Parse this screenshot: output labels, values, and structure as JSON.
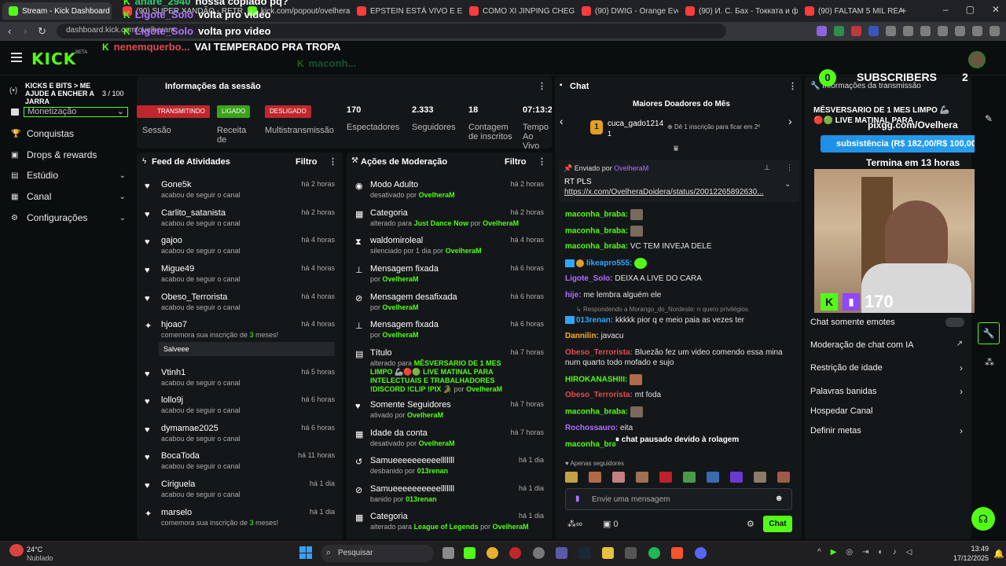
{
  "browser": {
    "tabs": [
      {
        "label": "Stream - Kick Dashboard",
        "active": true,
        "fav": "#53fc18"
      },
      {
        "label": "(90) SUPER XANDÃO - RETRA",
        "fav": "#ff3b3b"
      },
      {
        "label": "kick.com/popout/ovelheram/c",
        "fav": "#53fc18"
      },
      {
        "label": "EPSTEIN ESTÁ VIVO E EU POSS",
        "fav": "#ff3b3b"
      },
      {
        "label": "COMO XI JINPING CHEGOU AO",
        "fav": "#ff3b3b"
      },
      {
        "label": "(90) DWIG - Orange Evening /",
        "fav": "#ff3b3b"
      },
      {
        "label": "(90) И. С. Бах - Токката и фуга",
        "fav": "#ff3b3b"
      },
      {
        "label": "(90) FALTAM 5 MIL REAIS PARA",
        "fav": "#ff3b3b"
      }
    ],
    "new_tab": "+",
    "url": "dashboard.kick.com/ovelheram"
  },
  "overlay": {
    "lines": [
      {
        "user": "anare_2940",
        "text": "nossa copiado pq?"
      },
      {
        "user": "Ligote_Solo",
        "text": "volta pro video",
        "color": "pink"
      },
      {
        "user": "Ligote_Solo",
        "text": "volta pro video",
        "color": "pink"
      },
      {
        "user": "nenemquerbo...",
        "text": "VAI TEMPERADO PRA TROPA",
        "color": "red"
      },
      {
        "user": "maconh...",
        "text": ""
      }
    ]
  },
  "kick": {
    "logo": "KICK",
    "beta": "BETA"
  },
  "goal": {
    "title": "KICKS E BITS > ME AJUDE A ENCHER A JARRA",
    "count": "3 / 100",
    "monetization": "Monetização"
  },
  "sidebar": {
    "items": [
      {
        "label": "Conquistas",
        "icon": "trophy-icon",
        "chevron": false
      },
      {
        "label": "Drops & rewards",
        "icon": "gift-icon",
        "chevron": false
      },
      {
        "label": "Estúdio",
        "icon": "studio-icon",
        "chevron": true
      },
      {
        "label": "Canal",
        "icon": "channel-icon",
        "chevron": true
      },
      {
        "label": "Configurações",
        "icon": "gear-icon",
        "chevron": true
      }
    ]
  },
  "session": {
    "title": "Informações da sessão",
    "badges": [
      {
        "label": "TRANSMITINDO",
        "color": "#c0272d"
      },
      {
        "label": "LIGADO",
        "color": "#3aa31a"
      },
      {
        "label": "DESLIGADO",
        "color": "#c0272d"
      }
    ],
    "badge_captions": [
      "Sessão",
      "Receita de",
      "Multistransmissão"
    ],
    "stats": [
      {
        "value": "170",
        "label": "Espectadores"
      },
      {
        "value": "2.333",
        "label": "Seguidores"
      },
      {
        "value": "18",
        "label": "Contagem de inscritos"
      },
      {
        "value": "07:13:22",
        "label": "Tempo Ao Vivo"
      }
    ]
  },
  "feed": {
    "title": "Feed de Atividades",
    "filter": "Filtro",
    "rows": [
      {
        "name": "Gone5k",
        "desc": "acabou de seguir o canal",
        "time": "há 2 horas",
        "icon": "heart"
      },
      {
        "name": "Carlito_satanista",
        "desc": "acabou de seguir o canal",
        "time": "há 2 horas",
        "icon": "heart"
      },
      {
        "name": "gajoo",
        "desc": "acabou de seguir o canal",
        "time": "há 4 horas",
        "icon": "heart"
      },
      {
        "name": "Migue49",
        "desc": "acabou de seguir o canal",
        "time": "há 4 horas",
        "icon": "heart"
      },
      {
        "name": "Obeso_Terrorista",
        "desc": "acabou de seguir o canal",
        "time": "há 4 horas",
        "icon": "heart"
      },
      {
        "name": "hjoao7",
        "desc_pre": "comemora sua inscrição de ",
        "desc_num": "3",
        "desc_post": " meses!",
        "time": "há 4 horas",
        "icon": "star",
        "msg": "Salveee"
      },
      {
        "name": "Vtinh1",
        "desc": "acabou de seguir o canal",
        "time": "há 5 horas",
        "icon": "heart"
      },
      {
        "name": "lollo9j",
        "desc": "acabou de seguir o canal",
        "time": "há 6 horas",
        "icon": "heart"
      },
      {
        "name": "dymamae2025",
        "desc": "acabou de seguir o canal",
        "time": "há 6 horas",
        "icon": "heart"
      },
      {
        "name": "BocaToda",
        "desc": "acabou de seguir o canal",
        "time": "há 11 horas",
        "icon": "heart"
      },
      {
        "name": "Ciriguela",
        "desc": "acabou de seguir o canal",
        "time": "há 1 dia",
        "icon": "heart"
      },
      {
        "name": "marselo",
        "desc_pre": "comemora sua inscrição de ",
        "desc_num": "3",
        "desc_post": " meses!",
        "time": "há 1 dia",
        "icon": "star"
      }
    ]
  },
  "moderation": {
    "title": "Ações de Moderação",
    "filter": "Filtro",
    "rows": [
      {
        "name": "Modo Adulto",
        "desc": "desativado por",
        "by": "OvelheraM",
        "time": "há 2 horas",
        "icon": "eye"
      },
      {
        "name": "Categoria",
        "desc": "alterado para",
        "extra": "Just Dance Now",
        "mid": "por",
        "by": "OvelheraM",
        "time": "há 2 horas",
        "icon": "category"
      },
      {
        "name": "waldomiroleal",
        "desc": "silenciado por 1 dia por",
        "by": "OvelheraM",
        "time": "há 4 horas",
        "icon": "hourglass"
      },
      {
        "name": "Mensagem fixada",
        "desc": "por",
        "by": "OvelheraM",
        "time": "há 6 horas",
        "icon": "pin"
      },
      {
        "name": "Mensagem desafixada",
        "desc": "por",
        "by": "OvelheraM",
        "time": "há 6 horas",
        "icon": "unpin"
      },
      {
        "name": "Mensagem fixada",
        "desc": "por",
        "by": "OvelheraM",
        "time": "há 6 horas",
        "icon": "pin"
      },
      {
        "name": "Título",
        "desc": "alterado para",
        "extra": "MÊSVERSARIO DE 1 MES LIMPO 🦾🔴🟢 LIVE MATINAL PARA INTELECTUAIS E TRABALHADORES !DISCORD !CLIP !PIX 🐊",
        "mid": "por",
        "by": "OvelheraM",
        "time": "há 7 horas",
        "icon": "title"
      },
      {
        "name": "Somente Seguidores",
        "desc": "ativado por",
        "by": "OvelheraM",
        "time": "há 7 horas",
        "icon": "heart"
      },
      {
        "name": "Idade da conta",
        "desc": "desativado por",
        "by": "OvelheraM",
        "time": "há 7 horas",
        "icon": "calendar"
      },
      {
        "name": "Samueeeeeeeeeelllllll",
        "desc": "desbanido por",
        "by": "013renan",
        "time": "há 1 dia",
        "icon": "undo"
      },
      {
        "name": "Samueeeeeeeeeelllllll",
        "desc": "banido por",
        "by": "013renan",
        "time": "há 1 dia",
        "icon": "ban"
      },
      {
        "name": "Categoria",
        "desc": "alterado para",
        "extra": "League of Legends",
        "mid": "por",
        "by": "OvelheraM",
        "time": "há 1 dia",
        "icon": "category"
      }
    ]
  },
  "chat": {
    "title": "Chat",
    "donors_title": "Maiores Doadores do Mês",
    "top_donor": "cuca_gado1214",
    "top_donor_rank": "1",
    "top_donor_count": "1",
    "second_hint": "Dê 1 inscrição para ficar em 2º",
    "pinned_by": "Enviado por",
    "pinned_user": "OvelheraM",
    "pinned_text": "RT PLS",
    "pinned_link": "https://x.com/OvelheraDoidera/status/20012265892630...",
    "replying": "Respondendo a Morango_do_Nordeste: n quero privilégios",
    "messages": [
      {
        "user": "maconha_braba:",
        "text": "",
        "color": "#53fc18",
        "emote": true
      },
      {
        "user": "maconha_braba:",
        "text": "",
        "color": "#53fc18",
        "emote": true
      },
      {
        "user": "maconha_braba:",
        "text": "VC TEM INVEJA DELE",
        "color": "#53fc18"
      },
      {
        "user": "likeapro555:",
        "text": "",
        "color": "#2fa6ff",
        "emote": true
      },
      {
        "user": "Ligote_Solo:",
        "text": "DEIXA A LIVE DO CARA",
        "color": "#b070ff"
      },
      {
        "user": "hije:",
        "text": "me lembra alguém ele",
        "color": "#b070ff"
      },
      {
        "user": "013renan:",
        "text": "kkkkk pior q e meio paia as vezes ter",
        "color": "#2fa6ff",
        "reply": true
      },
      {
        "user": "Dannilin:",
        "text": "javacu",
        "color": "#ffb020"
      },
      {
        "user": "Obeso_Terrorista:",
        "text": "Bluezão fez um video comendo essa mina num quarto todo mofado e sujo",
        "color": "#e04a55"
      },
      {
        "user": "HIROKANASHIII:",
        "text": "",
        "color": "#53fc18",
        "emote": true
      },
      {
        "user": "Obeso_Terrorista:",
        "text": "mt foda",
        "color": "#e04a55"
      },
      {
        "user": "maconha_braba:",
        "text": "",
        "color": "#53fc18",
        "emote": true
      },
      {
        "user": "Rochossauro:",
        "text": "eita",
        "color": "#b070ff"
      },
      {
        "user": "maconha_brab",
        "text": "",
        "color": "#53fc18"
      }
    ],
    "paused": "chat pausado devido à rolagem",
    "followers_only": "Apenas seguidores",
    "input_placeholder": "Envie uma mensagem",
    "send": "Chat",
    "count": "0"
  },
  "right": {
    "subs_label": "SUBSCRIBERS",
    "subs_left": "0",
    "subs_right": "2",
    "panel_title": "Informações da transmissão",
    "stream_title": "MÊSVERSARIO DE 1 MES LIMPO 🦾🔴🟢 LIVE MATINAL PARA INTELECTUAIS",
    "pix": "pixgg.com/Ovelhera",
    "goal_text": "subsistência (R$ 182,00/R$ 100,00)",
    "ends": "Termina em 13 horas",
    "viewers": "170",
    "settings": [
      {
        "label": "Chat somente emotes",
        "control": "toggle"
      },
      {
        "label": "Moderação de chat com IA",
        "control": "external"
      },
      {
        "label": "Restrição de idade",
        "control": "chevron"
      },
      {
        "label": "Palavras banidas",
        "control": "chevron"
      },
      {
        "label": "Hospedar Canal",
        "control": "none"
      },
      {
        "label": "Definir metas",
        "control": "chevron"
      }
    ]
  },
  "taskbar": {
    "weather_temp": "24°C",
    "weather_desc": "Nublado",
    "search": "Pesquisar",
    "time": "13:49",
    "date": "17/12/2025"
  }
}
